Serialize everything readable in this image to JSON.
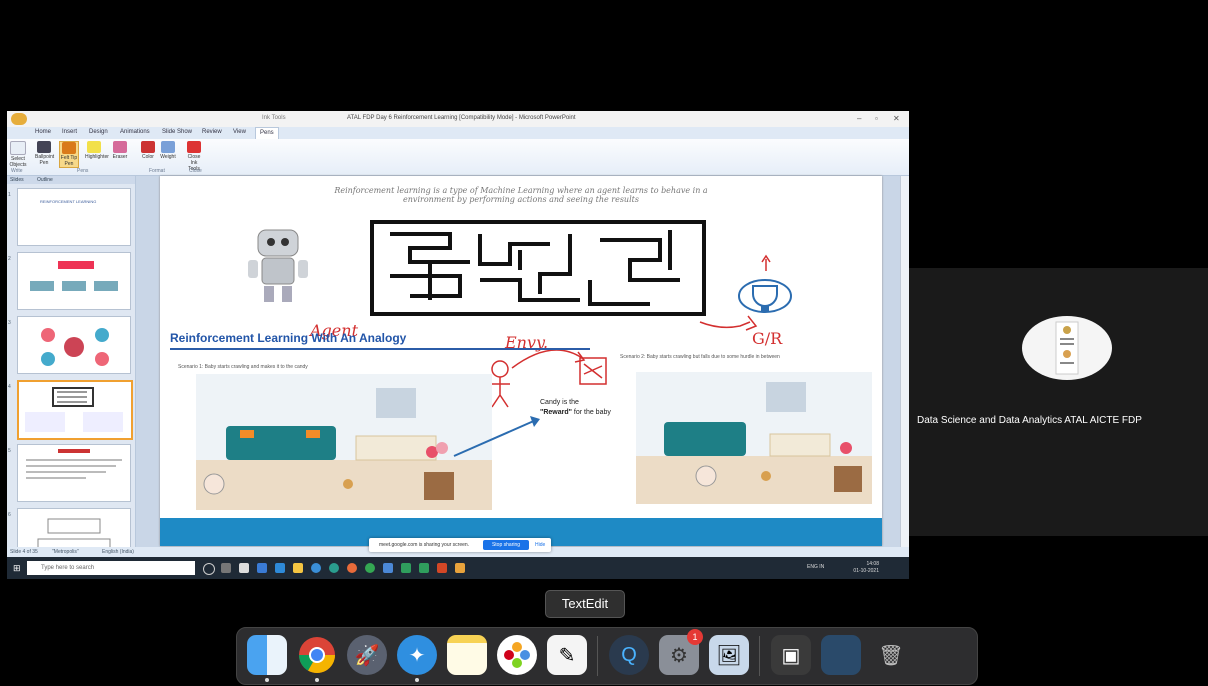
{
  "powerpoint": {
    "window_title": "ATAL FDP Day 6 Reinforcement Learning [Compatibility Mode] - Microsoft PowerPoint",
    "context_tab": "Ink Tools",
    "tabs": [
      "Home",
      "Insert",
      "Design",
      "Animations",
      "Slide Show",
      "Review",
      "View",
      "Pens"
    ],
    "active_tab": "Pens",
    "ribbon": {
      "buttons": [
        "Select Objects",
        "Ballpoint Pen",
        "Felt Tip Pen",
        "Highlighter",
        "Eraser",
        "Color",
        "Weight",
        "Close Ink Tools"
      ],
      "groups": [
        "Write",
        "Pens",
        "Format",
        "Close"
      ]
    },
    "panel_tabs": [
      "Slides",
      "Outline"
    ],
    "slide_numbers": [
      "1",
      "2",
      "3",
      "4",
      "5",
      "6"
    ],
    "thumb1_title": "REINFORCEMENT LEARNING",
    "slide": {
      "header_line1": "Reinforcement learning is a type of Machine Learning where an agent learns to behave in a",
      "header_line2": "environment by performing actions and seeing the results",
      "section_title": "Reinforcement Learning With An Analogy",
      "scenario1": "Scenario 1: Baby starts crawling and makes it to the candy",
      "scenario2": "Scenario 2: Baby starts crawling but falls due to some hurdle in between",
      "candy_line1": "Candy is the",
      "candy_bold": "\"Reward\"",
      "candy_line2": " for the baby",
      "ink_agent": "Agent",
      "ink_env": "Envy.",
      "ink_gr": "G/R"
    },
    "statusbar": [
      "Slide 4 of 35",
      "\"Metropolis\"",
      "English (India)"
    ],
    "share_banner": {
      "message": "meet.google.com is sharing your screen.",
      "stop": "Stop sharing",
      "hide": "Hide"
    },
    "taskbar": {
      "search_placeholder": "Type here to search",
      "time": "14:08",
      "date": "01-10-2021",
      "lang": "ENG IN"
    }
  },
  "participant": {
    "name": "Data Science and Data Analytics ATAL AICTE FDP"
  },
  "dock": {
    "tooltip": "TextEdit",
    "apps": [
      "Finder",
      "Chrome",
      "Launchpad",
      "Safari",
      "Notes",
      "Photos",
      "TextEdit",
      "QuickTime Player",
      "System Preferences",
      "Preview",
      "Screenshot",
      "Mission Control",
      "Trash"
    ],
    "badge": "1"
  }
}
